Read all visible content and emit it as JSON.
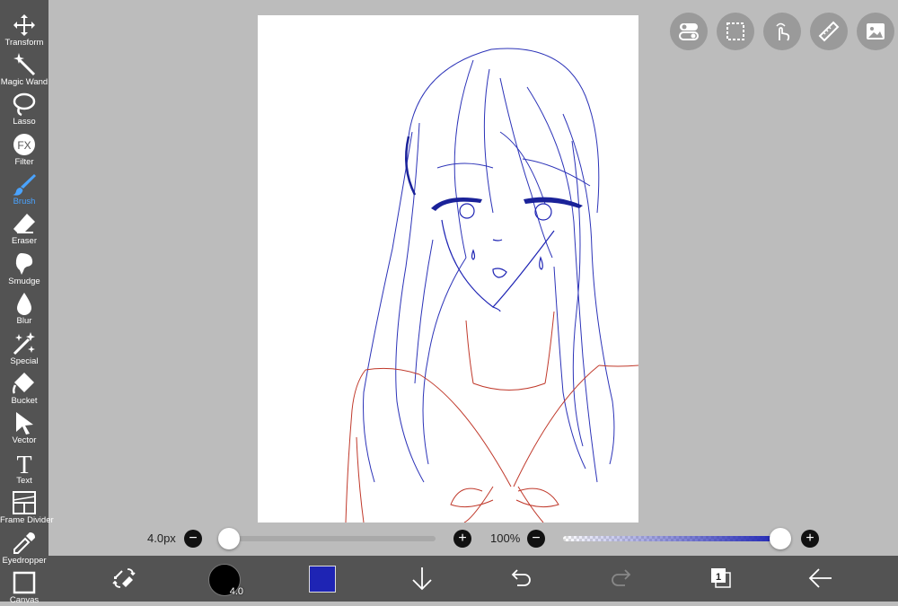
{
  "sidebar": {
    "tools": [
      {
        "label": "Transform",
        "icon": "move-icon"
      },
      {
        "label": "Magic Wand",
        "icon": "magic-wand-icon"
      },
      {
        "label": "Lasso",
        "icon": "lasso-icon"
      },
      {
        "label": "Filter",
        "icon": "fx-icon"
      },
      {
        "label": "Brush",
        "icon": "brush-icon"
      },
      {
        "label": "Eraser",
        "icon": "eraser-icon"
      },
      {
        "label": "Smudge",
        "icon": "smudge-icon"
      },
      {
        "label": "Blur",
        "icon": "drop-icon"
      },
      {
        "label": "Special",
        "icon": "sparkle-wand-icon"
      },
      {
        "label": "Bucket",
        "icon": "bucket-icon"
      },
      {
        "label": "Vector",
        "icon": "vector-cursor-icon"
      },
      {
        "label": "Text",
        "icon": "text-icon"
      },
      {
        "label": "Frame Divider",
        "icon": "frame-divider-icon"
      },
      {
        "label": "Eyedropper",
        "icon": "eyedropper-icon"
      },
      {
        "label": "Canvas",
        "icon": "canvas-icon"
      }
    ],
    "active_tool": "Brush",
    "filter_glyph": "FX",
    "text_glyph": "T"
  },
  "top_buttons": [
    "toggle-settings-icon",
    "selection-icon",
    "hand-touch-icon",
    "ruler-icon",
    "image-icon"
  ],
  "brush_size": {
    "label": "4.0px",
    "value": 4.0,
    "fraction": 0.04
  },
  "opacity": {
    "label": "100%",
    "fraction": 1.0
  },
  "bottom_bar": {
    "brush_size_badge": "4.0",
    "layer_count": "1",
    "color": "#1e24b4"
  },
  "colors": {
    "accent": "#4aa3ff",
    "panel": "#535353",
    "background": "#bcbcbc"
  }
}
